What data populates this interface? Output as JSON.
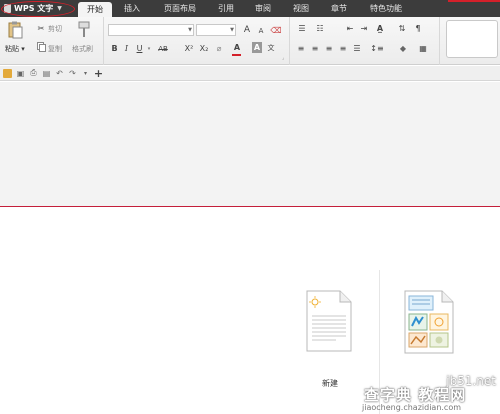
{
  "app_menu": {
    "label": "WPS 文字"
  },
  "tabs": [
    {
      "label": "开始",
      "active": true
    },
    {
      "label": "插入",
      "active": false
    },
    {
      "label": "页面布局",
      "active": false
    },
    {
      "label": "引用",
      "active": false
    },
    {
      "label": "审阅",
      "active": false
    },
    {
      "label": "视图",
      "active": false
    },
    {
      "label": "章节",
      "active": false
    },
    {
      "label": "特色功能",
      "active": false
    }
  ],
  "clipboard": {
    "paste_label": "粘贴",
    "cut_label": "剪切",
    "copy_label": "复制",
    "format_painter_label": "格式刷"
  },
  "font": {
    "name_value": "",
    "size_value": "",
    "bold_glyph": "B",
    "italic_glyph": "I",
    "underline_glyph": "U",
    "strikethrough_glyph": "AB",
    "superscript_glyph": "X²",
    "subscript_glyph": "X₂",
    "grow_glyph": "A",
    "shrink_glyph": "A",
    "font_color_glyph": "A",
    "highlight_glyph": "A",
    "char_shading_glyph": "A",
    "phonetic_glyph": "文",
    "font_color": "#d4202a",
    "highlight_color": "#f5e000"
  },
  "quick_access": [
    "open-icon",
    "save-icon",
    "print-icon",
    "print-preview-icon",
    "undo-icon",
    "redo-icon",
    "customize-icon",
    "new-tab-icon"
  ],
  "start_page": {
    "new_label": "新建"
  },
  "watermark": {
    "url": "jb51.net",
    "brand": "查字典 教程网",
    "domain": "jiaocheng.chazidian.com"
  },
  "colors": {
    "menubar_bg": "#3c3c3c",
    "accent_red": "#d4202a",
    "ribbon_bg": "#f2f2f2"
  }
}
